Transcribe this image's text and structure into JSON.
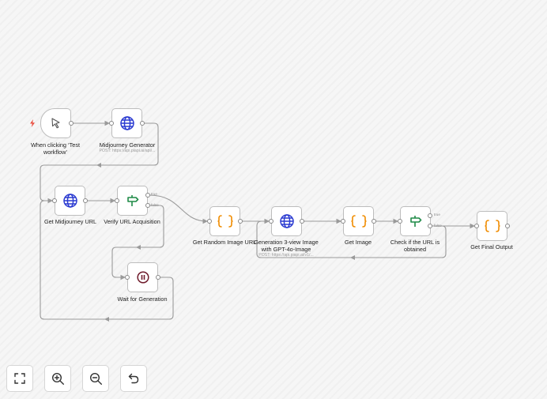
{
  "nodes": {
    "trigger": {
      "label": "When clicking ‘Test workflow’"
    },
    "midjourney_generator": {
      "label": "Midjourney Generator",
      "subtitle": "POST: https://api.piapi.ai/api/..."
    },
    "get_midjourney_url": {
      "label": "Get Midjourney URL"
    },
    "verify_url": {
      "label": "Verify URL Acquisition",
      "true_label": "true",
      "false_label": "false"
    },
    "wait_generation": {
      "label": "Wait for Generation"
    },
    "get_random_image_url": {
      "label": "Get Random Image URL"
    },
    "generation_3view": {
      "label": "Generation 3-view Image with GPT-4o-Image",
      "subtitle": "POST: https://api.piapi.ai/v1/..."
    },
    "get_image": {
      "label": "Get Image"
    },
    "check_url": {
      "label": "Check if the URL is obtained",
      "true_label": "true",
      "false_label": "false"
    },
    "get_final_output": {
      "label": "Get Final Output"
    }
  },
  "controls": {
    "fit_view": {
      "icon": "fit-view-icon"
    },
    "zoom_in": {
      "icon": "zoom-in-icon"
    },
    "zoom_out": {
      "icon": "zoom-out-icon"
    },
    "undo": {
      "icon": "undo-icon"
    }
  },
  "colors": {
    "http_icon": "#2b3bd1",
    "code_icon": "#f08c00",
    "if_icon": "#1f8a47",
    "wait_icon": "#6f1b2b",
    "trigger_bolt": "#ea4b3c",
    "connection": "#9a9a9a"
  }
}
